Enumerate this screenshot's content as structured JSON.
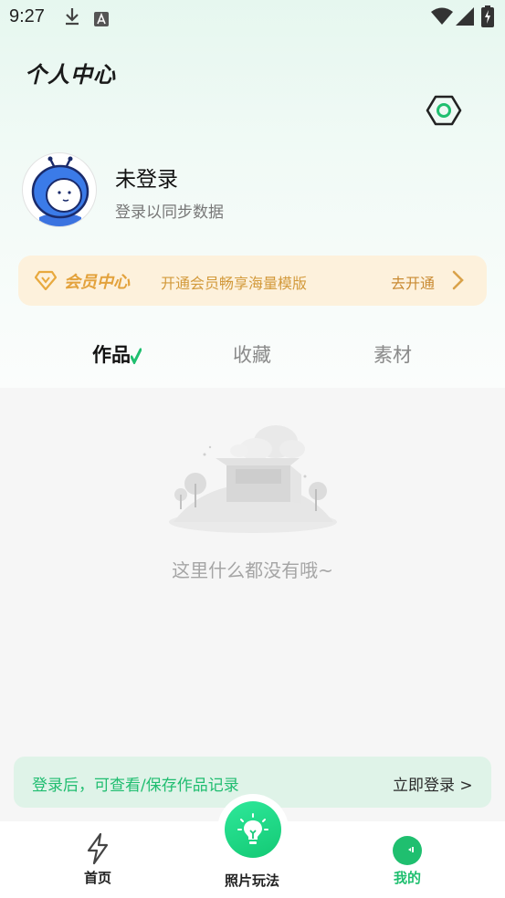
{
  "status_bar": {
    "time": "9:27"
  },
  "header": {
    "title": "个人中心"
  },
  "user": {
    "name": "未登录",
    "subtitle": "登录以同步数据"
  },
  "vip": {
    "title": "会员中心",
    "description": "开通会员畅享海量模版",
    "action": "去开通"
  },
  "tabs": [
    {
      "label": "作品",
      "active": true
    },
    {
      "label": "收藏",
      "active": false
    },
    {
      "label": "素材",
      "active": false
    }
  ],
  "empty_state": {
    "message": "这里什么都没有哦~"
  },
  "login_banner": {
    "text": "登录后，可查看/保存作品记录",
    "link": "立即登录 >"
  },
  "bottom_nav": {
    "home": "首页",
    "center": "照片玩法",
    "mine": "我的"
  },
  "colors": {
    "accent": "#1fbf6f",
    "vip_gold": "#e3a23c",
    "banner_bg": "#dff3e8"
  }
}
